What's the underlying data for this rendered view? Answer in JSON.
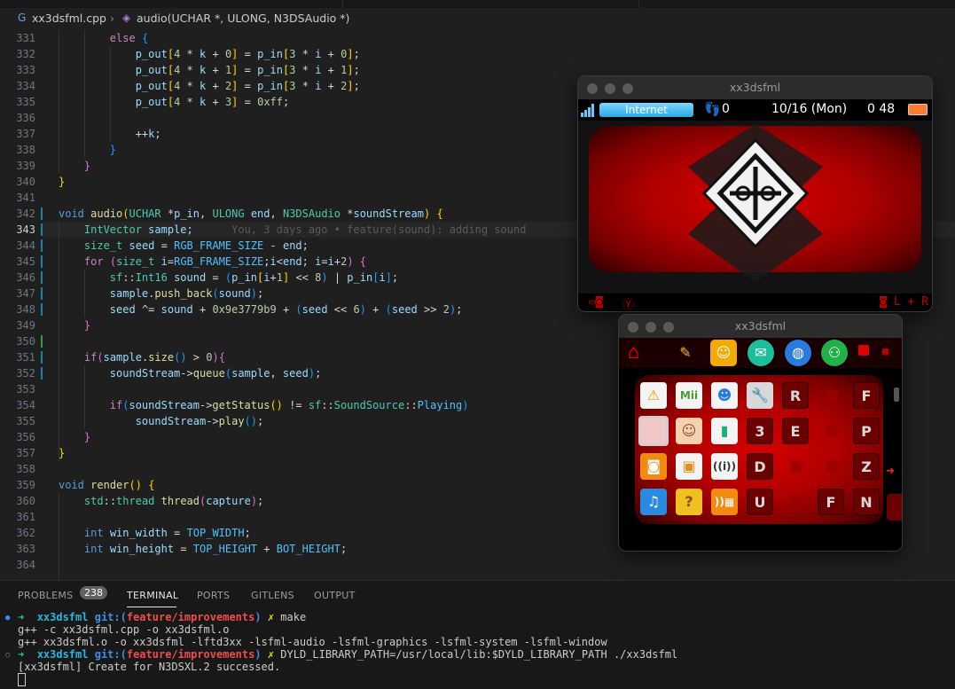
{
  "breadcrumb": {
    "file": "xx3dsfml.cpp",
    "file_icon": "cpp-file-icon",
    "symbol": "audio(UCHAR *, ULONG, N3DSAudio *)",
    "symbol_icon": "method-cube-icon"
  },
  "editor": {
    "line_numbers": [
      "331",
      "332",
      "333",
      "334",
      "335",
      "336",
      "337",
      "338",
      "339",
      "340",
      "341",
      "342",
      "343",
      "344",
      "345",
      "346",
      "347",
      "348",
      "349",
      "350",
      "351",
      "352",
      "353",
      "354",
      "355",
      "356",
      "357",
      "358",
      "359",
      "360",
      "361",
      "362",
      "363",
      "364"
    ],
    "blame": "You, 3 days ago • feature(sound): adding sound"
  },
  "panel": {
    "tabs": [
      "PROBLEMS",
      "TERMINAL",
      "PORTS",
      "GITLENS",
      "OUTPUT"
    ],
    "problems_count": "238",
    "active_tab": "TERMINAL"
  },
  "terminal": {
    "prompt_arrow": "➜",
    "dir": "xx3dsfml",
    "git_prefix": "git:(",
    "branch": "feature/improvements",
    "git_suffix": ")",
    "dirty": "✗",
    "cmd1": "make",
    "out1": "g++ -c xx3dsfml.cpp -o xx3dsfml.o",
    "out2": "g++ xx3dsfml.o -o xx3dsfml -lftd3xx -lsfml-audio -lsfml-graphics -lsfml-system -lsfml-window",
    "cmd2": "DYLD_LIBRARY_PATH=/usr/local/lib:$DYLD_LIBRARY_PATH ./xx3dsfml",
    "out3": "[xx3dsfml] Create for N3DSXL.2 successed."
  },
  "top_window": {
    "title": "xx3dsfml",
    "status": {
      "net_label": "Internet",
      "streetpass": "0",
      "date": "10/16 (Mon)",
      "time": "0 48"
    },
    "colors": {
      "accent_red": "#c00000",
      "net_blue": "#2aa8e0",
      "battery": "#ff7b2e"
    }
  },
  "bottom_window": {
    "title": "xx3dsfml",
    "folder_letters": [
      "R",
      "F",
      "3",
      "E",
      "P",
      "D",
      "Z",
      "U",
      "F",
      "N"
    ]
  }
}
